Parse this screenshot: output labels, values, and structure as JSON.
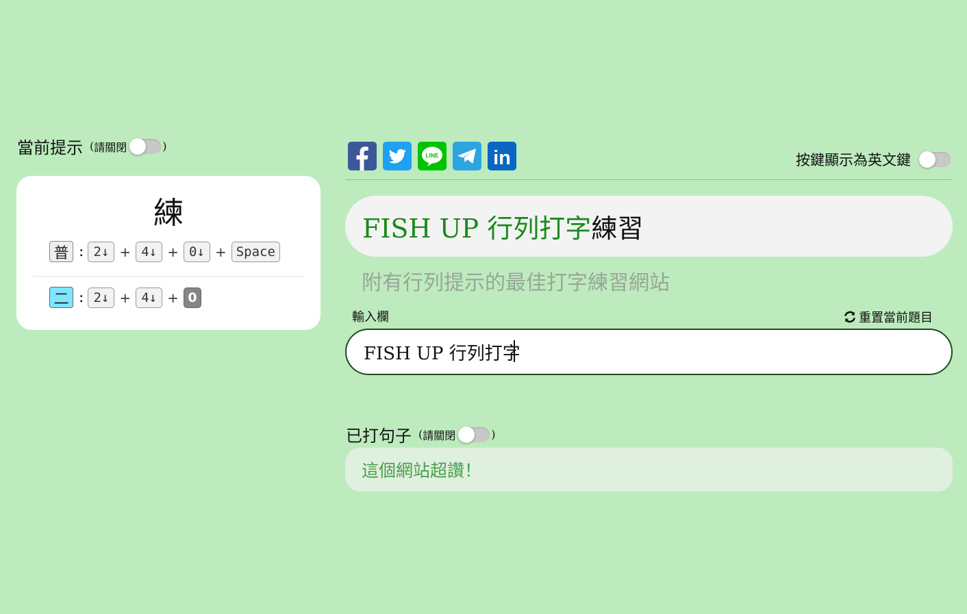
{
  "hint_panel": {
    "title": "當前提示",
    "note_open": "(",
    "note_text": "請關閉",
    "note_close": ")",
    "toggle_on": false,
    "current_char": "練",
    "rows": [
      {
        "mode": "普",
        "keys": [
          "2↓",
          "4↓",
          "0↓",
          "Space"
        ]
      },
      {
        "mode": "二",
        "keys": [
          "2↓",
          "4↓",
          "0"
        ]
      }
    ],
    "colon": ":",
    "plus": "+"
  },
  "share": {
    "icons": [
      "facebook-icon",
      "twitter-icon",
      "line-icon",
      "telegram-icon",
      "linkedin-icon"
    ],
    "line_label": "LINE",
    "linkedin_label": "in",
    "colors": {
      "facebook": "#3b5998",
      "twitter": "#1da1f2",
      "line": "#00c300",
      "telegram": "#2ca5e0",
      "linkedin": "#0a66c2"
    }
  },
  "settings": {
    "english_keys_label": "按鍵顯示為英文鍵",
    "english_keys_on": false
  },
  "practice": {
    "title_typed": "FISH UP 行列打字",
    "title_untyped": "練習",
    "subtitle": "附有行列提示的最佳打字練習網站",
    "input_label": "輸入欄",
    "reset_label": "重置當前題目",
    "input_value": "FISH UP 行列打字"
  },
  "typed_sentences": {
    "title": "已打句子",
    "note_open": "(",
    "note_text": "請關閉",
    "note_close": ")",
    "toggle_on": false,
    "items": [
      "這個網站超讚！"
    ]
  },
  "colors": {
    "background": "#bdebbd",
    "typed_text": "#1a8a1a",
    "input_border": "#1d4d1d",
    "done_text": "#4aa04a"
  }
}
